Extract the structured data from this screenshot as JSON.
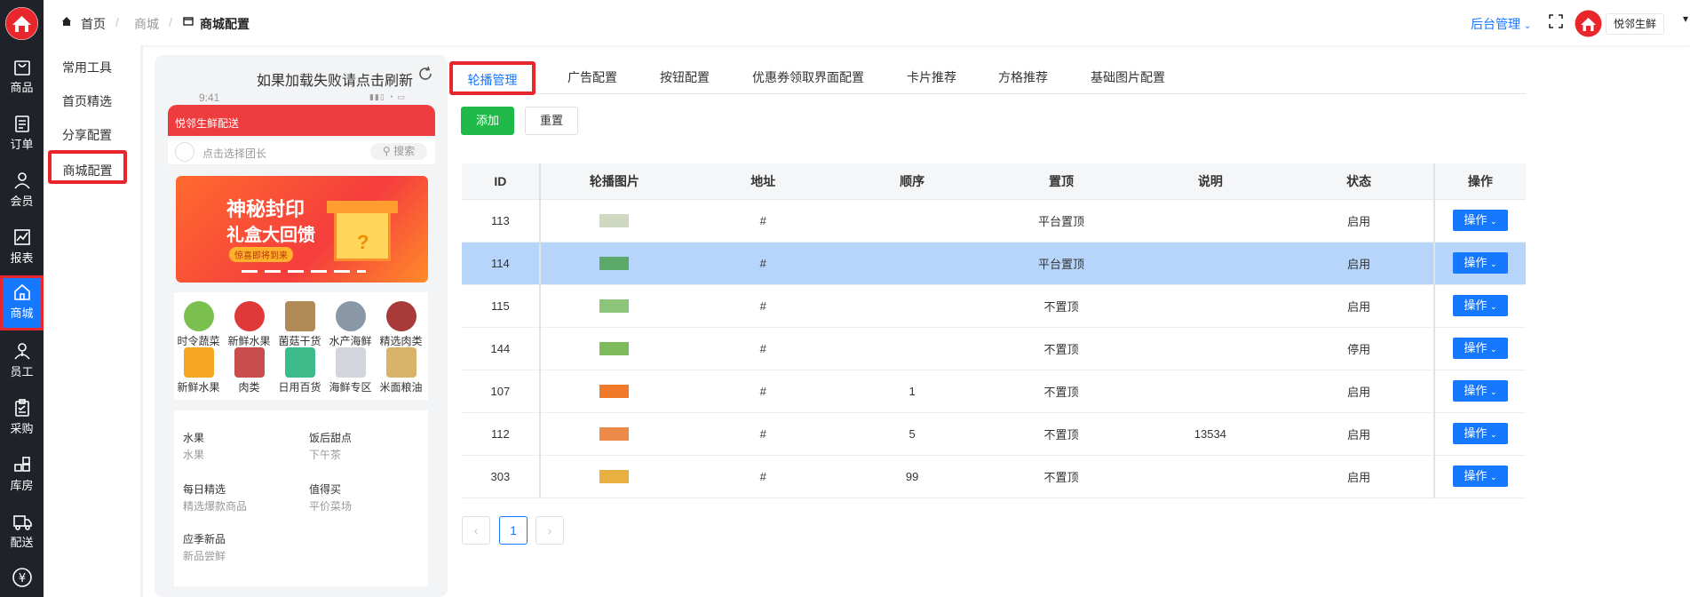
{
  "rail": {
    "items": [
      {
        "label": "商城",
        "icon": "store-logo-icon"
      },
      {
        "label": "商品",
        "icon": "bag-icon"
      },
      {
        "label": "订单",
        "icon": "order-icon"
      },
      {
        "label": "会员",
        "icon": "user-icon"
      },
      {
        "label": "报表",
        "icon": "chart-icon"
      },
      {
        "label": "商城",
        "icon": "home-icon"
      },
      {
        "label": "员工",
        "icon": "staff-icon"
      },
      {
        "label": "采购",
        "icon": "clipboard-icon"
      },
      {
        "label": "库房",
        "icon": "grid-icon"
      },
      {
        "label": "配送",
        "icon": "truck-icon"
      },
      {
        "label": "¥",
        "icon": "yen-icon"
      }
    ]
  },
  "subnav": {
    "items": [
      "常用工具",
      "首页精选",
      "分享配置",
      "商城配置"
    ]
  },
  "header": {
    "breadcrumb": [
      "首页",
      "商城",
      "商城配置"
    ],
    "admin_label": "后台管理",
    "user_name": "悦邻生鲜"
  },
  "phone": {
    "refresh_hint": "如果加载失败请点击刷新",
    "time": "9:41",
    "store_title": "悦邻生鲜配送",
    "choose_leader": "点击选择团长",
    "search_label": "搜索",
    "banner_line1": "神秘封印",
    "banner_line2": "礼盒大回馈",
    "banner_tag": "惊喜即将到来",
    "categories": [
      "时令蔬菜",
      "新鲜水果",
      "菌菇干货",
      "水产海鲜",
      "精选肉类",
      "新鲜水果",
      "肉类",
      "日用百货",
      "海鲜专区",
      "米面粮油"
    ],
    "recs": [
      {
        "title": "水果",
        "sub": "水果"
      },
      {
        "title": "饭后甜点",
        "sub": "下午茶"
      },
      {
        "title": "每日精选",
        "sub": "精选爆款商品"
      },
      {
        "title": "值得买",
        "sub": "平价菜场"
      },
      {
        "title": "应季新品",
        "sub": "新品尝鲜"
      }
    ]
  },
  "tabs": [
    "轮播管理",
    "广告配置",
    "按钮配置",
    "优惠券领取界面配置",
    "卡片推荐",
    "方格推荐",
    "基础图片配置"
  ],
  "toolbar": {
    "add_label": "添加",
    "reset_label": "重置"
  },
  "table": {
    "columns": [
      "ID",
      "轮播图片",
      "地址",
      "顺序",
      "置顶",
      "说明",
      "状态",
      "操作"
    ],
    "op_label": "操作",
    "rows": [
      {
        "id": "113",
        "addr": "#",
        "order": "",
        "top": "平台置顶",
        "desc": "",
        "status": "启用",
        "thumb": "#cfd8c0"
      },
      {
        "id": "114",
        "addr": "#",
        "order": "",
        "top": "平台置顶",
        "desc": "",
        "status": "启用",
        "thumb": "#5aa86a"
      },
      {
        "id": "115",
        "addr": "#",
        "order": "",
        "top": "不置顶",
        "desc": "",
        "status": "启用",
        "thumb": "#8cc47a"
      },
      {
        "id": "144",
        "addr": "#",
        "order": "",
        "top": "不置顶",
        "desc": "",
        "status": "停用",
        "thumb": "#7dbb5a"
      },
      {
        "id": "107",
        "addr": "#",
        "order": "1",
        "top": "不置顶",
        "desc": "",
        "status": "启用",
        "thumb": "#f07a2a"
      },
      {
        "id": "112",
        "addr": "#",
        "order": "5",
        "top": "不置顶",
        "desc": "13534",
        "status": "启用",
        "thumb": "#ec8a4a"
      },
      {
        "id": "303",
        "addr": "#",
        "order": "99",
        "top": "不置顶",
        "desc": "",
        "status": "启用",
        "thumb": "#e8b040"
      }
    ]
  },
  "pagination": {
    "current": "1"
  }
}
